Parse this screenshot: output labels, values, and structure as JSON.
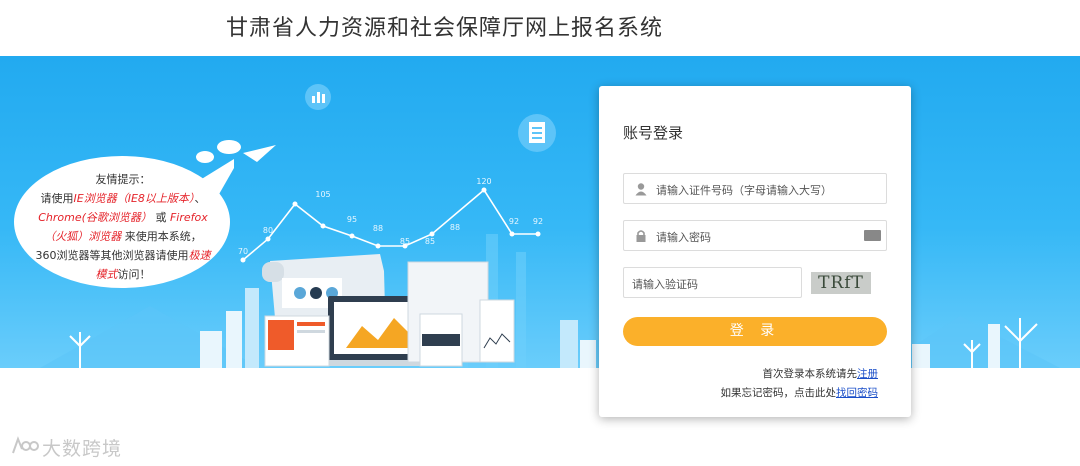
{
  "header": {
    "title": "甘肃省人力资源和社会保障厅网上报名系统"
  },
  "tip": {
    "title": "友情提示：",
    "line1_pre": "请使用",
    "line1_red": "IE浏览器（IE8以上版本）",
    "line1_post": "、",
    "line2_red": "Chrome(谷歌浏览器）",
    "line2_mid": "或",
    "line2_red2": "Firefox（火狐）浏览器",
    "line3": "来使用本系统，360浏览器等其他浏览器请使用",
    "line3_red": "极速模式",
    "line3_post": "访问！"
  },
  "chart_labels": [
    "70",
    "80",
    "105",
    "95",
    "88",
    "85",
    "85",
    "88",
    "120",
    "92",
    "92"
  ],
  "login": {
    "title": "账号登录",
    "id_placeholder": "请输入证件号码（字母请输入大写）",
    "password_placeholder": "请输入密码",
    "captcha_placeholder": "请输入验证码",
    "captcha_text": "TRfT",
    "button": "登 录",
    "register_prefix": "首次登录本系统请先",
    "register_link": "注册",
    "forgot_prefix": "如果忘记密码，点击此处",
    "forgot_link": "找回密码"
  },
  "watermark": {
    "text": "大数跨境"
  },
  "icons": [
    "user-icon",
    "lock-icon",
    "keyboard-icon",
    "paper-plane-icon",
    "document-icon",
    "bar-chart-icon"
  ]
}
